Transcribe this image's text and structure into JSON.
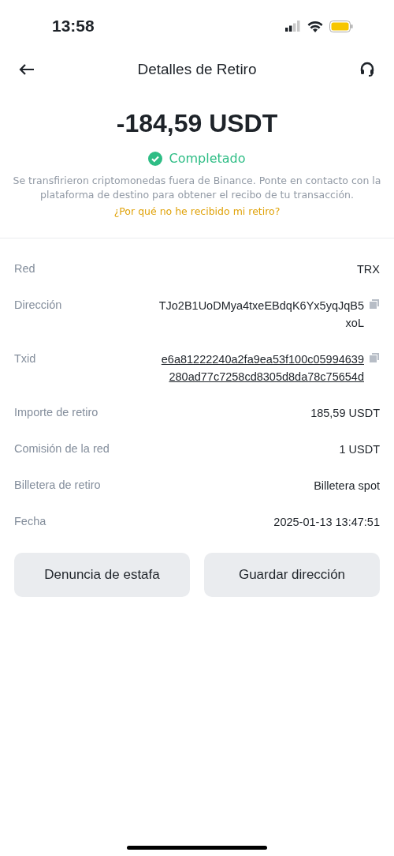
{
  "status_bar": {
    "time": "13:58"
  },
  "header": {
    "title": "Detalles de Retiro"
  },
  "summary": {
    "amount": "-184,59 USDT",
    "status": "Completado",
    "message": "Se transfirieron criptomonedas fuera de Binance. Ponte en contacto con la plataforma de destino para obtener el recibo de tu transacción.",
    "help_link": "¿Por qué no he recibido mi retiro?"
  },
  "details": [
    {
      "label": "Red",
      "value": "TRX",
      "kind": "text"
    },
    {
      "label": "Dirección",
      "value": "TJo2B1UoDMya4txeEBdqK6Yx5yqJqB5xoL",
      "kind": "copy"
    },
    {
      "label": "Txid",
      "value": "e6a81222240a2fa9ea53f100c05994639280ad77c7258cd8305d8da78c75654d",
      "kind": "link"
    },
    {
      "label": "Importe de retiro",
      "value": "185,59 USDT",
      "kind": "text"
    },
    {
      "label": "Comisión de la red",
      "value": "1 USDT",
      "kind": "text"
    },
    {
      "label": "Billetera de retiro",
      "value": "Billetera spot",
      "kind": "text"
    },
    {
      "label": "Fecha",
      "value": "2025-01-13 13:47:51",
      "kind": "text"
    }
  ],
  "buttons": [
    "Denuncia de estafa",
    "Guardar dirección"
  ]
}
